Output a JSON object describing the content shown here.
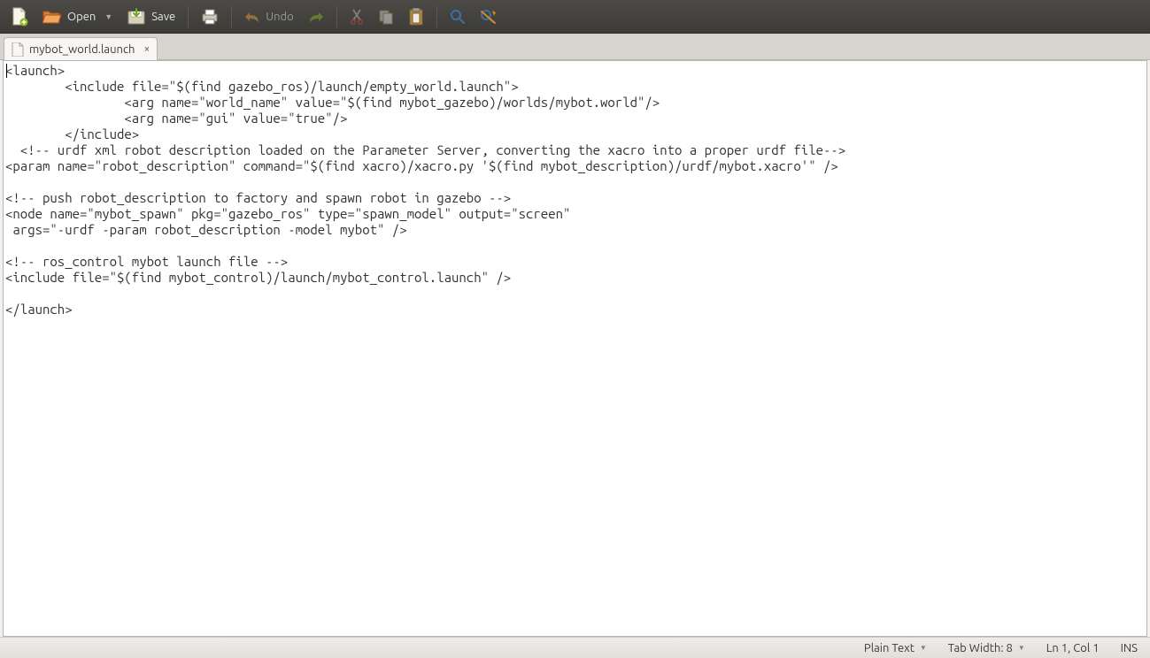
{
  "toolbar": {
    "open_label": "Open",
    "save_label": "Save",
    "undo_label": "Undo"
  },
  "tab": {
    "filename": "mybot_world.launch"
  },
  "editor": {
    "content": "<launch>\n        <include file=\"$(find gazebo_ros)/launch/empty_world.launch\">\n                <arg name=\"world_name\" value=\"$(find mybot_gazebo)/worlds/mybot.world\"/>\n                <arg name=\"gui\" value=\"true\"/>\n        </include>\n  <!-- urdf xml robot description loaded on the Parameter Server, converting the xacro into a proper urdf file-->\n<param name=\"robot_description\" command=\"$(find xacro)/xacro.py '$(find mybot_description)/urdf/mybot.xacro'\" />\n\n<!-- push robot_description to factory and spawn robot in gazebo -->\n<node name=\"mybot_spawn\" pkg=\"gazebo_ros\" type=\"spawn_model\" output=\"screen\"\n args=\"-urdf -param robot_description -model mybot\" />\n\n<!-- ros_control mybot launch file -->\n<include file=\"$(find mybot_control)/launch/mybot_control.launch\" />\n\n</launch>\n"
  },
  "status": {
    "language": "Plain Text",
    "tab_width": "Tab Width: 8",
    "position": "Ln 1, Col 1",
    "insert_mode": "INS"
  }
}
